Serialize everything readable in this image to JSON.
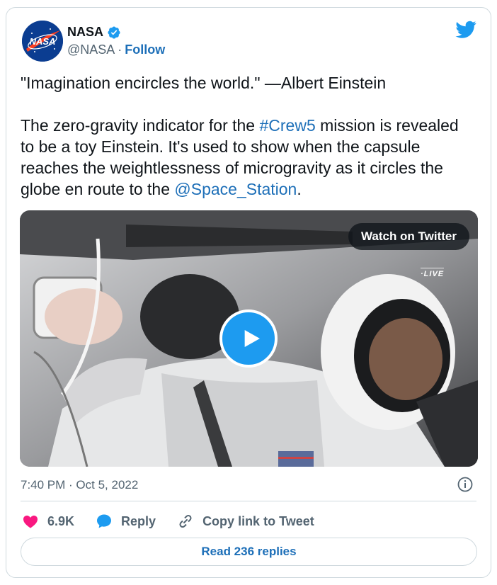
{
  "author": {
    "name": "NASA",
    "handle": "@NASA",
    "separator": "·",
    "follow_label": "Follow",
    "verified": true,
    "avatar_logo_text": "NASA"
  },
  "tweet": {
    "line1": "\"Imagination encircles the world.\" —Albert Einstein",
    "p2_before": "The zero-gravity indicator for the ",
    "hashtag": "#Crew5",
    "p2_middle": " mission is revealed to be a toy Einstein. It's used to show when the capsule reaches the weightlessness of microgravity as it circles the globe en route to the ",
    "mention": "@Space_Station",
    "p2_after": "."
  },
  "media": {
    "watch_label": "Watch on Twitter",
    "live_label": "LIVE"
  },
  "timestamp": "7:40 PM · Oct 5, 2022",
  "actions": {
    "like_count": "6.9K",
    "reply_label": "Reply",
    "copy_label": "Copy link to Tweet"
  },
  "read_replies_label": "Read 236 replies",
  "colors": {
    "link": "#1d6fb8",
    "twitter_blue": "#1d9bf0",
    "like_red": "#f91880",
    "muted": "#536471",
    "border": "#cfd9de"
  },
  "icons": [
    "nasa-logo",
    "verified-badge-icon",
    "twitter-bird-icon",
    "play-icon",
    "info-icon",
    "heart-icon",
    "reply-bubble-icon",
    "link-icon"
  ]
}
